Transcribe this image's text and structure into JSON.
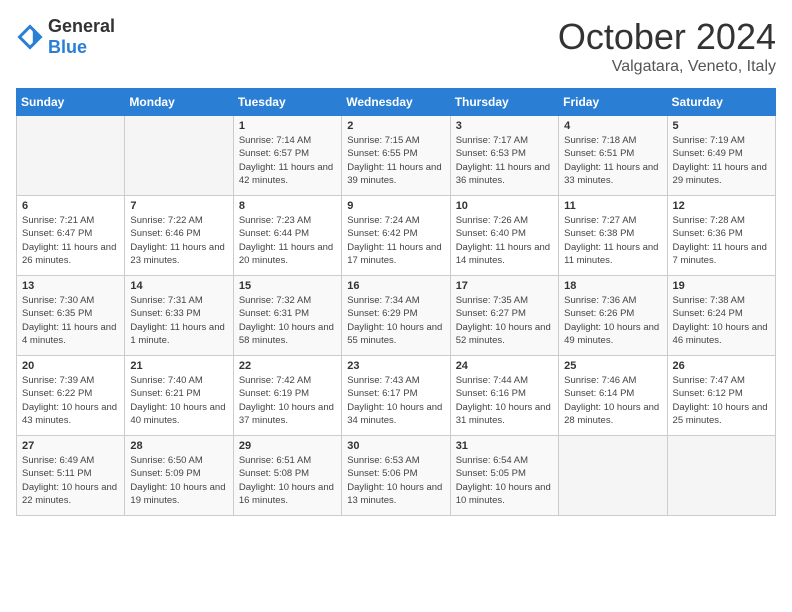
{
  "header": {
    "logo_general": "General",
    "logo_blue": "Blue",
    "month_year": "October 2024",
    "location": "Valgatara, Veneto, Italy"
  },
  "days_of_week": [
    "Sunday",
    "Monday",
    "Tuesday",
    "Wednesday",
    "Thursday",
    "Friday",
    "Saturday"
  ],
  "weeks": [
    [
      {
        "day": "",
        "info": ""
      },
      {
        "day": "",
        "info": ""
      },
      {
        "day": "1",
        "info": "Sunrise: 7:14 AM\nSunset: 6:57 PM\nDaylight: 11 hours and 42 minutes."
      },
      {
        "day": "2",
        "info": "Sunrise: 7:15 AM\nSunset: 6:55 PM\nDaylight: 11 hours and 39 minutes."
      },
      {
        "day": "3",
        "info": "Sunrise: 7:17 AM\nSunset: 6:53 PM\nDaylight: 11 hours and 36 minutes."
      },
      {
        "day": "4",
        "info": "Sunrise: 7:18 AM\nSunset: 6:51 PM\nDaylight: 11 hours and 33 minutes."
      },
      {
        "day": "5",
        "info": "Sunrise: 7:19 AM\nSunset: 6:49 PM\nDaylight: 11 hours and 29 minutes."
      }
    ],
    [
      {
        "day": "6",
        "info": "Sunrise: 7:21 AM\nSunset: 6:47 PM\nDaylight: 11 hours and 26 minutes."
      },
      {
        "day": "7",
        "info": "Sunrise: 7:22 AM\nSunset: 6:46 PM\nDaylight: 11 hours and 23 minutes."
      },
      {
        "day": "8",
        "info": "Sunrise: 7:23 AM\nSunset: 6:44 PM\nDaylight: 11 hours and 20 minutes."
      },
      {
        "day": "9",
        "info": "Sunrise: 7:24 AM\nSunset: 6:42 PM\nDaylight: 11 hours and 17 minutes."
      },
      {
        "day": "10",
        "info": "Sunrise: 7:26 AM\nSunset: 6:40 PM\nDaylight: 11 hours and 14 minutes."
      },
      {
        "day": "11",
        "info": "Sunrise: 7:27 AM\nSunset: 6:38 PM\nDaylight: 11 hours and 11 minutes."
      },
      {
        "day": "12",
        "info": "Sunrise: 7:28 AM\nSunset: 6:36 PM\nDaylight: 11 hours and 7 minutes."
      }
    ],
    [
      {
        "day": "13",
        "info": "Sunrise: 7:30 AM\nSunset: 6:35 PM\nDaylight: 11 hours and 4 minutes."
      },
      {
        "day": "14",
        "info": "Sunrise: 7:31 AM\nSunset: 6:33 PM\nDaylight: 11 hours and 1 minute."
      },
      {
        "day": "15",
        "info": "Sunrise: 7:32 AM\nSunset: 6:31 PM\nDaylight: 10 hours and 58 minutes."
      },
      {
        "day": "16",
        "info": "Sunrise: 7:34 AM\nSunset: 6:29 PM\nDaylight: 10 hours and 55 minutes."
      },
      {
        "day": "17",
        "info": "Sunrise: 7:35 AM\nSunset: 6:27 PM\nDaylight: 10 hours and 52 minutes."
      },
      {
        "day": "18",
        "info": "Sunrise: 7:36 AM\nSunset: 6:26 PM\nDaylight: 10 hours and 49 minutes."
      },
      {
        "day": "19",
        "info": "Sunrise: 7:38 AM\nSunset: 6:24 PM\nDaylight: 10 hours and 46 minutes."
      }
    ],
    [
      {
        "day": "20",
        "info": "Sunrise: 7:39 AM\nSunset: 6:22 PM\nDaylight: 10 hours and 43 minutes."
      },
      {
        "day": "21",
        "info": "Sunrise: 7:40 AM\nSunset: 6:21 PM\nDaylight: 10 hours and 40 minutes."
      },
      {
        "day": "22",
        "info": "Sunrise: 7:42 AM\nSunset: 6:19 PM\nDaylight: 10 hours and 37 minutes."
      },
      {
        "day": "23",
        "info": "Sunrise: 7:43 AM\nSunset: 6:17 PM\nDaylight: 10 hours and 34 minutes."
      },
      {
        "day": "24",
        "info": "Sunrise: 7:44 AM\nSunset: 6:16 PM\nDaylight: 10 hours and 31 minutes."
      },
      {
        "day": "25",
        "info": "Sunrise: 7:46 AM\nSunset: 6:14 PM\nDaylight: 10 hours and 28 minutes."
      },
      {
        "day": "26",
        "info": "Sunrise: 7:47 AM\nSunset: 6:12 PM\nDaylight: 10 hours and 25 minutes."
      }
    ],
    [
      {
        "day": "27",
        "info": "Sunrise: 6:49 AM\nSunset: 5:11 PM\nDaylight: 10 hours and 22 minutes."
      },
      {
        "day": "28",
        "info": "Sunrise: 6:50 AM\nSunset: 5:09 PM\nDaylight: 10 hours and 19 minutes."
      },
      {
        "day": "29",
        "info": "Sunrise: 6:51 AM\nSunset: 5:08 PM\nDaylight: 10 hours and 16 minutes."
      },
      {
        "day": "30",
        "info": "Sunrise: 6:53 AM\nSunset: 5:06 PM\nDaylight: 10 hours and 13 minutes."
      },
      {
        "day": "31",
        "info": "Sunrise: 6:54 AM\nSunset: 5:05 PM\nDaylight: 10 hours and 10 minutes."
      },
      {
        "day": "",
        "info": ""
      },
      {
        "day": "",
        "info": ""
      }
    ]
  ]
}
